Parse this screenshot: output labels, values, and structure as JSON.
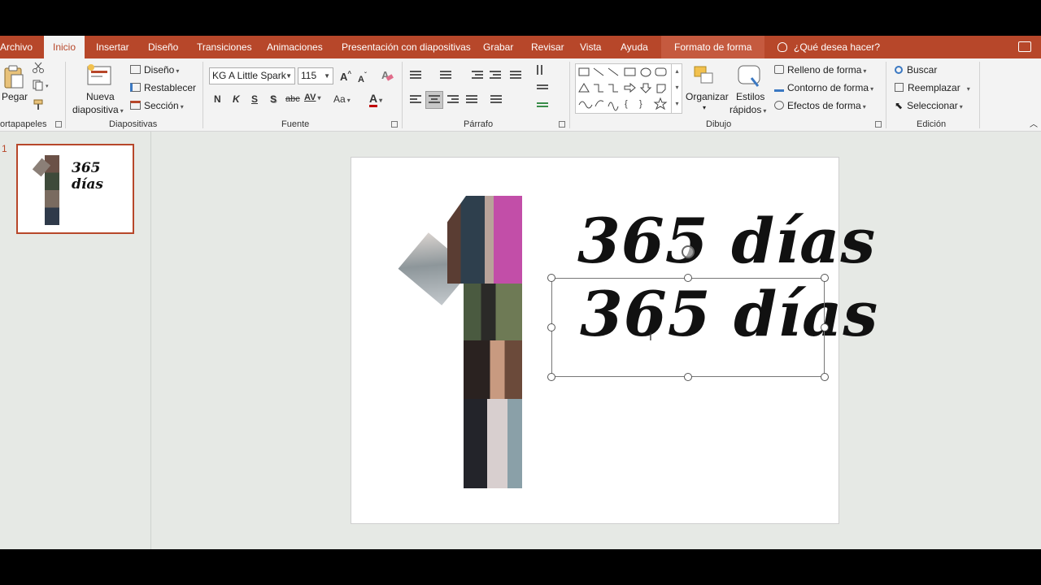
{
  "tabs": {
    "archivo": "Archivo",
    "inicio": "Inicio",
    "insertar": "Insertar",
    "diseno": "Diseño",
    "transiciones": "Transiciones",
    "animaciones": "Animaciones",
    "presentacion": "Presentación con diapositivas",
    "grabar": "Grabar",
    "revisar": "Revisar",
    "vista": "Vista",
    "ayuda": "Ayuda",
    "formato_forma": "Formato de forma",
    "tell_me": "¿Qué desea hacer?"
  },
  "clipboard": {
    "pegar": "Pegar",
    "label": "ortapapeles"
  },
  "slides_group": {
    "nueva_line1": "Nueva",
    "nueva_line2": "diapositiva",
    "diseno": "Diseño",
    "restablecer": "Restablecer",
    "seccion": "Sección",
    "label": "Diapositivas"
  },
  "font": {
    "name": "KG A Little Spark",
    "size": "115",
    "bold": "N",
    "italic": "K",
    "underline": "S",
    "shadow": "S",
    "strike": "abc",
    "spacing": "AV",
    "case": "Aa",
    "color_letter": "A",
    "grow": "A",
    "shrink": "A",
    "label": "Fuente",
    "color_accent": "#c00000"
  },
  "paragraph": {
    "label": "Párrafo"
  },
  "drawing": {
    "organizar": "Organizar",
    "estilos_line1": "Estilos",
    "estilos_line2": "rápidos",
    "relleno": "Relleno de forma",
    "contorno": "Contorno de forma",
    "efectos": "Efectos de forma",
    "label": "Dibujo"
  },
  "editing": {
    "buscar": "Buscar",
    "reemplazar": "Reemplazar",
    "seleccionar": "Seleccionar",
    "label": "Edición"
  },
  "thumbnail": {
    "number": "1",
    "title": "365 días"
  },
  "slide": {
    "title_top": "365 días",
    "title_selected": "365 días"
  },
  "colors": {
    "accent": "#b7472a",
    "ribbon_bg": "#f3f3f3",
    "workspace": "#e6e9e5"
  }
}
